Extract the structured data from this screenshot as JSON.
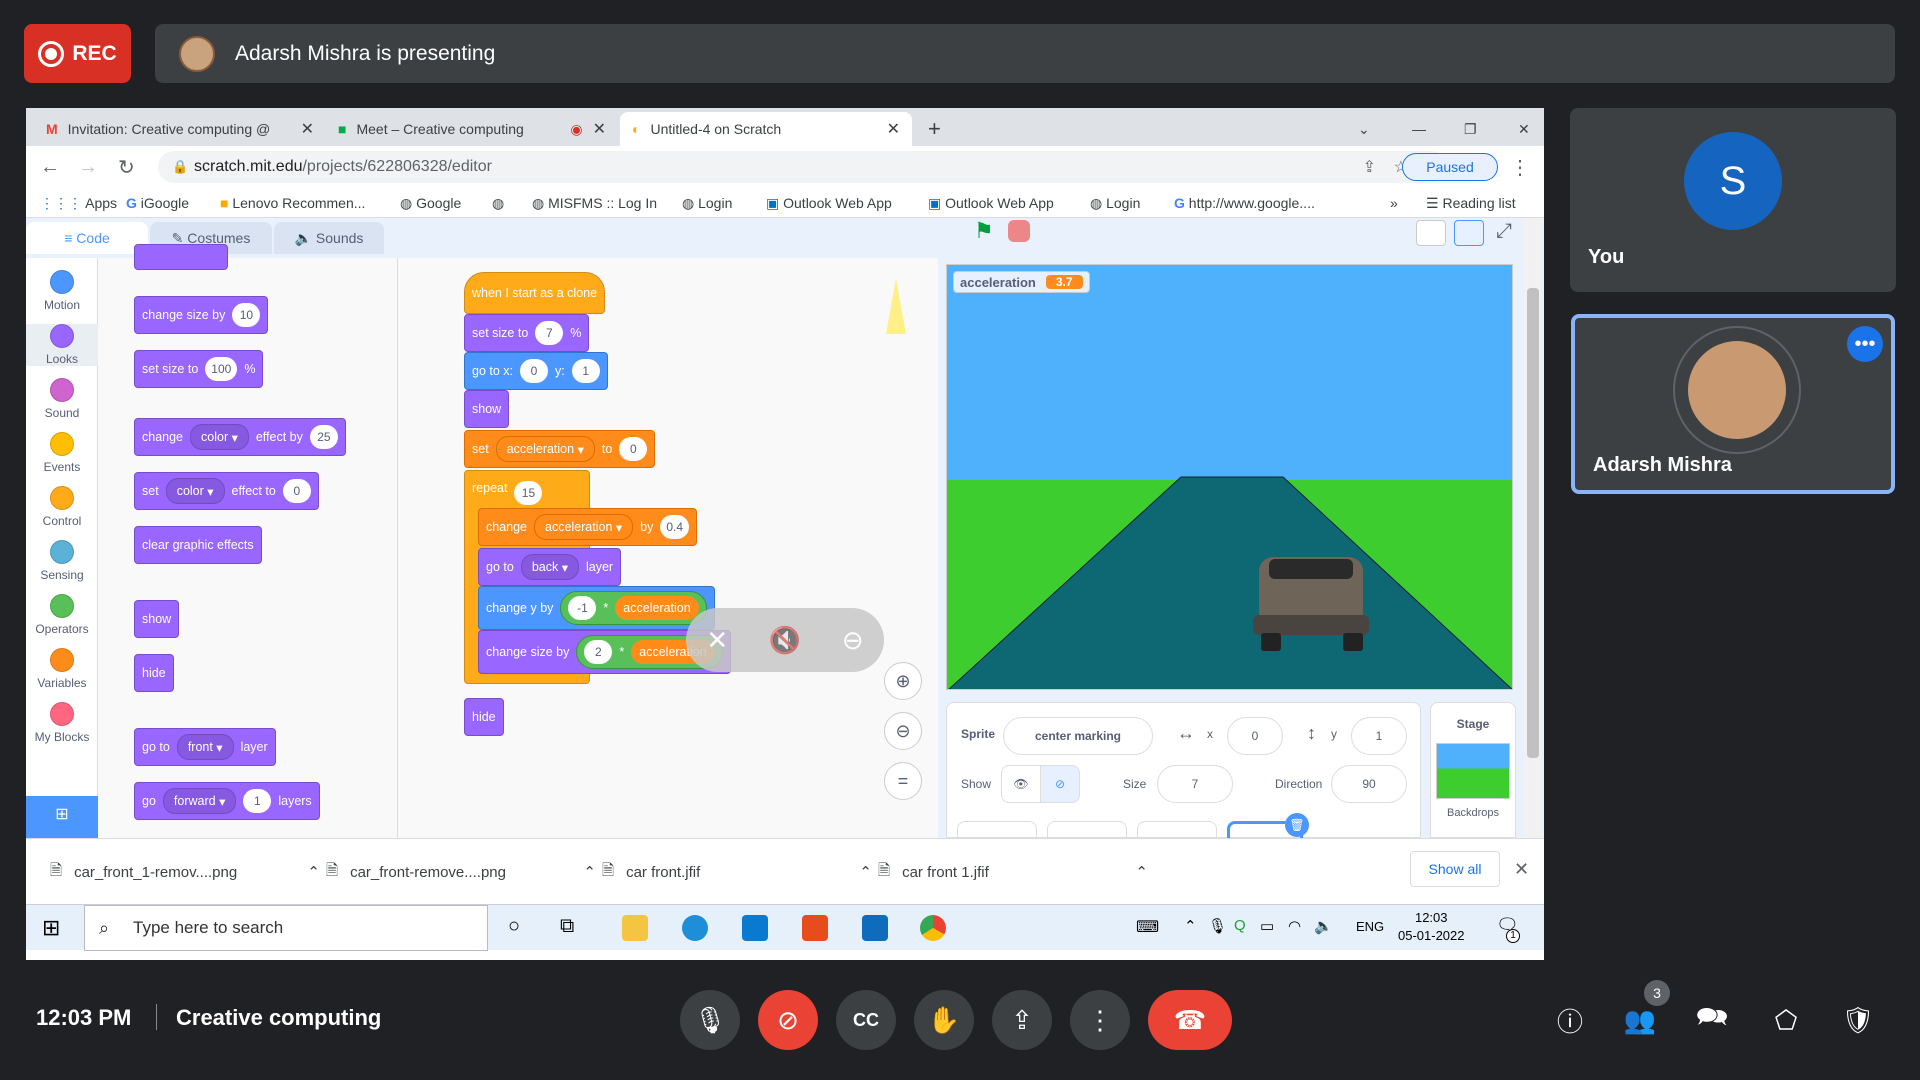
{
  "meet": {
    "rec_label": "REC",
    "presenter_text": "Adarsh Mishra is presenting",
    "time": "12:03 PM",
    "meeting_name": "Creative computing",
    "participant_count": "3",
    "tiles": [
      {
        "name": "You",
        "initial": "S"
      },
      {
        "name": "Adarsh Mishra"
      }
    ]
  },
  "browser": {
    "tabs": [
      {
        "label": "Invitation: Creative computing @"
      },
      {
        "label": "Meet – Creative computing"
      },
      {
        "label": "Untitled-4 on Scratch"
      }
    ],
    "url_domain": "scratch.mit.edu",
    "url_path": "/projects/622806328/editor",
    "paused_label": "Paused",
    "bookmarks": [
      "Apps",
      "iGoogle",
      "Lenovo Recommen...",
      "Google",
      "MISFMS :: Log In",
      "Login",
      "Outlook Web App",
      "Outlook Web App",
      "Login",
      "http://www.google...."
    ],
    "bookmarks_more": "»",
    "reading_list": "Reading list"
  },
  "scratch": {
    "tabs": {
      "code": "Code",
      "costumes": "Costumes",
      "sounds": "Sounds"
    },
    "categories": [
      {
        "label": "Motion",
        "color": "#4c97ff"
      },
      {
        "label": "Looks",
        "color": "#9966ff"
      },
      {
        "label": "Sound",
        "color": "#cf63cf"
      },
      {
        "label": "Events",
        "color": "#ffbf00"
      },
      {
        "label": "Control",
        "color": "#ffab19"
      },
      {
        "label": "Sensing",
        "color": "#5cb1d6"
      },
      {
        "label": "Operators",
        "color": "#59c059"
      },
      {
        "label": "Variables",
        "color": "#ff8c1a"
      },
      {
        "label": "My Blocks",
        "color": "#ff6680"
      }
    ],
    "palette": {
      "change_size": {
        "text": "change size by",
        "value": "10"
      },
      "set_size": {
        "text": "set size to",
        "value": "100",
        "unit": "%"
      },
      "change_effect": {
        "t1": "change",
        "drop": "color",
        "t2": "effect by",
        "value": "25"
      },
      "set_effect": {
        "t1": "set",
        "drop": "color",
        "t2": "effect to",
        "value": "0"
      },
      "clear": "clear graphic effects",
      "show": "show",
      "hide": "hide",
      "goto_layer": {
        "t1": "go to",
        "drop": "front",
        "t2": "layer"
      },
      "go_layers": {
        "t1": "go",
        "drop": "forward",
        "value": "1",
        "t2": "layers"
      }
    },
    "script": {
      "hat": "when I start as a clone",
      "set_size": {
        "text": "set size to",
        "value": "7",
        "unit": "%"
      },
      "goto": {
        "text": "go to x:",
        "x": "0",
        "ylab": "y:",
        "y": "1"
      },
      "show": "show",
      "set_var": {
        "t1": "set",
        "drop": "acceleration",
        "t2": "to",
        "value": "0"
      },
      "repeat": {
        "text": "repeat",
        "value": "15"
      },
      "change_var": {
        "t1": "change",
        "drop": "acceleration",
        "t2": "by",
        "value": "0.4"
      },
      "goto_layer": {
        "t1": "go to",
        "drop": "back",
        "t2": "layer"
      },
      "change_y": {
        "text": "change y by",
        "a": "-1",
        "op": "*",
        "b": "acceleration"
      },
      "change_size": {
        "text": "change size by",
        "a": "2",
        "op": "*",
        "b": "acceleration"
      },
      "hide": "hide"
    },
    "monitor": {
      "label": "acceleration",
      "value": "3.7"
    },
    "sprite": {
      "sprite_label": "Sprite",
      "name": "center marking",
      "x_label": "x",
      "x": "0",
      "y_label": "y",
      "y": "1",
      "show_label": "Show",
      "size_label": "Size",
      "size": "7",
      "direction_label": "Direction",
      "direction": "90"
    },
    "stage_panel": {
      "title": "Stage",
      "backdrops": "Backdrops"
    }
  },
  "downloads": {
    "items": [
      "car_front_1-remov....png",
      "car_front-remove....png",
      "car front.jfif",
      "car front 1.jfif"
    ],
    "show_all": "Show all"
  },
  "taskbar": {
    "search_placeholder": "Type here to search",
    "lang": "ENG",
    "clock_time": "12:03",
    "clock_date": "05-01-2022",
    "notif_count": "1"
  }
}
